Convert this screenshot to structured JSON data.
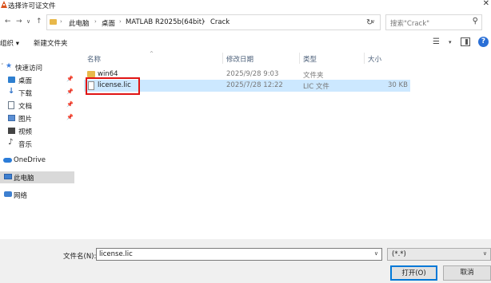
{
  "window": {
    "title": "选择许可证文件",
    "close_glyph": "✕"
  },
  "address": {
    "crumbs": [
      "此电脑",
      "桌面",
      "MATLAB R2025b(64bit)",
      "Crack"
    ],
    "search_placeholder": "搜索\"Crack\""
  },
  "toolbar": {
    "organize_label": "组织 ▾",
    "new_folder_label": "新建文件夹"
  },
  "nav": {
    "items": [
      {
        "label": "快速访问"
      },
      {
        "label": "桌面"
      },
      {
        "label": "下载"
      },
      {
        "label": "文档"
      },
      {
        "label": "图片"
      },
      {
        "label": "视频"
      },
      {
        "label": "音乐"
      },
      {
        "label": "OneDrive"
      },
      {
        "label": "此电脑"
      },
      {
        "label": "网络"
      }
    ]
  },
  "columns": {
    "name": "名称",
    "modified": "修改日期",
    "type": "类型",
    "size": "大小"
  },
  "files": [
    {
      "name": "win64",
      "modified": "2025/9/28 9:03",
      "type": "文件夹",
      "size": ""
    },
    {
      "name": "license.lic",
      "modified": "2025/7/28 12:22",
      "type": "LIC 文件",
      "size": "30 KB"
    }
  ],
  "footer": {
    "filename_label": "文件名(N):",
    "filename_value": "license.lic",
    "filter_value": "(*.*)",
    "open_label": "打开(O)",
    "cancel_label": "取消"
  },
  "colors": {
    "accent": "#0078d7",
    "selection": "#cce8ff",
    "highlight_box": "#e01414",
    "folder": "#e8b84a"
  },
  "icons": [
    "app-icon",
    "back-arrow-icon",
    "forward-arrow-icon",
    "up-arrow-icon",
    "folder-icon",
    "refresh-icon",
    "search-icon",
    "view-icon",
    "preview-pane-icon",
    "help-icon",
    "star-icon",
    "pin-icon",
    "file-icon"
  ]
}
